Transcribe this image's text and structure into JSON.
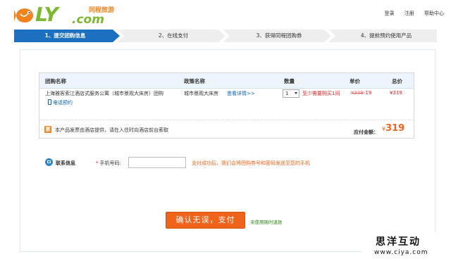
{
  "header": {
    "logo_text": "LY",
    "logo_dotcom": ".com",
    "logo_slogan": "同程旅游",
    "links": [
      "登录",
      "注册",
      "帮助中心"
    ]
  },
  "steps": [
    {
      "label": "1、提交团购信息",
      "active": true
    },
    {
      "label": "2、在线支付",
      "active": false
    },
    {
      "label": "3、获得同程团购券",
      "active": false
    },
    {
      "label": "4、提前预约使用产品",
      "active": false
    }
  ],
  "table": {
    "headers": {
      "name": "团购名称",
      "policy": "政策名称",
      "qty": "数量",
      "unit": "单价",
      "total": "总价"
    },
    "row": {
      "hotel_name": "上海雅客索江酒店式服务公寓（城市景观大床房）团购",
      "phone_link": "电话预约",
      "policy": "城市景观大床房",
      "detail_link": "查看详情>>",
      "qty": "1",
      "min_note": "至少需要购买1间",
      "unit_price_old": "¥338",
      "unit_price_sep": "-",
      "unit_price": "19",
      "total_price": "¥319"
    },
    "footer": {
      "invoice_icon": "票",
      "invoice_text": "本产品发票由酒店提供，请在入住时向酒店前台索取",
      "pay_label": "应付金额：",
      "pay_currency": "¥",
      "pay_amount": "319"
    }
  },
  "contact": {
    "title": "联系信息",
    "star": "*",
    "phone_label": "手机号码:",
    "phone_value": "",
    "hint": "支付成功后，我们会将团购券号和密码发送至您的手机"
  },
  "submit": {
    "label": "确认无误，支付",
    "refund_note": "未使用随时退款"
  },
  "watermark": {
    "title": "思洋互动",
    "url": "www.ciya.com"
  },
  "colors": {
    "brand_green": "#7cb82f",
    "accent_orange": "#f0631a",
    "step_active": "#1d6fbf",
    "link_blue": "#0b5fb0",
    "price_red": "#e0201f"
  }
}
